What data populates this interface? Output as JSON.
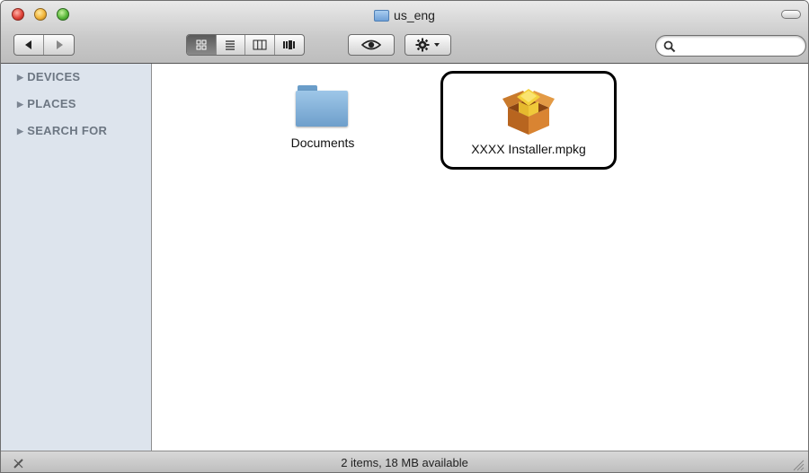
{
  "window": {
    "title": "us_eng"
  },
  "toolbar": {
    "back_icon": "back-arrow-icon",
    "forward_icon": "forward-arrow-icon",
    "view_modes": [
      "icon-view",
      "list-view",
      "column-view",
      "coverflow-view"
    ],
    "active_view": "icon-view",
    "search_placeholder": ""
  },
  "sidebar": {
    "items": [
      {
        "label": "DEVICES"
      },
      {
        "label": "PLACES"
      },
      {
        "label": "SEARCH FOR"
      }
    ]
  },
  "files": [
    {
      "label": "Documents",
      "icon": "folder-icon"
    },
    {
      "label": "XXXX Installer.mpkg",
      "icon": "package-icon",
      "highlighted": true
    }
  ],
  "statusbar": {
    "text": "2 items, 18 MB available"
  },
  "colors": {
    "sidebar_bg": "#dde4ed",
    "highlight_border": "#000000"
  }
}
